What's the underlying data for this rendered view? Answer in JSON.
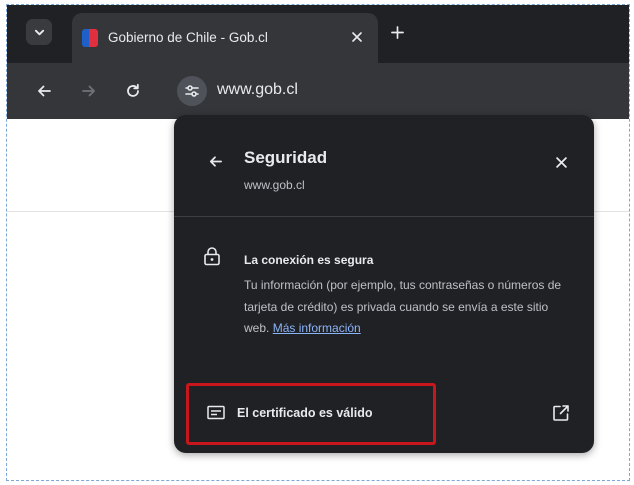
{
  "tabstrip": {
    "search_icon": "chevron-down-icon",
    "tab": {
      "title": "Gobierno de Chile - Gob.cl",
      "favicon": "chile-flag-icon"
    },
    "new_tab_icon": "plus-icon"
  },
  "toolbar": {
    "back_icon": "arrow-left-icon",
    "forward_icon": "arrow-right-icon",
    "reload_icon": "reload-icon",
    "site_info_icon": "tune-icon",
    "url": "www.gob.cl"
  },
  "security_popup": {
    "title": "Seguridad",
    "subtitle": "www.gob.cl",
    "connection_title": "La conexión es segura",
    "connection_description": "Tu información (por ejemplo, tus contraseñas o números de tarjeta de crédito) es privada cuando se envía a este sitio web.",
    "learn_more_link": "Más información",
    "certificate_label": "El certificado es válido",
    "highlight_color": "#c8161d"
  },
  "colors": {
    "tabstrip_bg": "#202124",
    "toolbar_bg": "#35363a",
    "popup_bg": "#202124",
    "link": "#8ab4f8"
  }
}
